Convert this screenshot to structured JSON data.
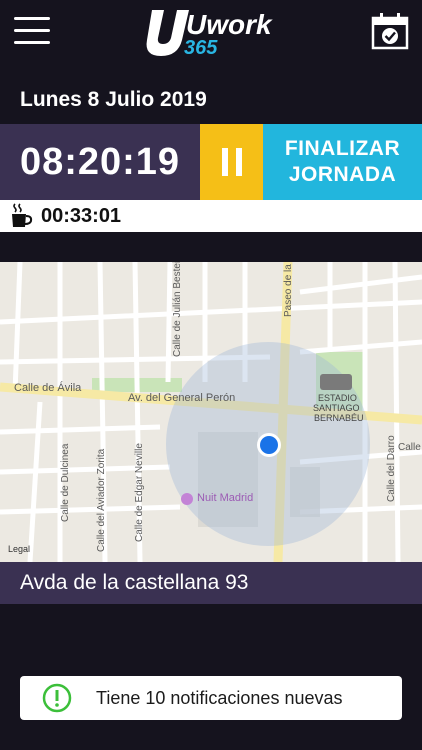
{
  "header": {
    "logo_main": "Uwork",
    "logo_sub": "365",
    "menu_icon": "hamburger-menu-icon",
    "calendar_icon": "calendar-check-icon"
  },
  "date": "Lunes 8 Julio 2019",
  "timer": {
    "elapsed": "08:20:19",
    "pause_icon": "pause-icon",
    "finish_line1": "FINALIZAR",
    "finish_line2": "JORNADA"
  },
  "break": {
    "icon": "coffee-cup-icon",
    "time": "00:33:01"
  },
  "map": {
    "labels": {
      "calle_avila": "Calle de Ávila",
      "general_peron": "Av. del General Perón",
      "estadio1": "ESTADIO",
      "estadio2": "SANTIAGO",
      "estadio3": "BERNABÉU",
      "nuit": "Nuit Madrid",
      "dulcinea": "Calle de Dulcinea",
      "aviador": "Calle del Aviador Zorita",
      "edgar": "Calle de Edgar Neville",
      "julian": "Calle de Julián Besteiro",
      "paseo": "Paseo de la",
      "darro": "Calle del Darro",
      "calle_l": "Calle L",
      "legal": "Legal"
    }
  },
  "address": "Avda de la castellana 93",
  "notification": {
    "icon": "exclamation-circle-icon",
    "text": "Tiene 10 notificaciones nuevas"
  },
  "colors": {
    "background": "#15131e",
    "timer_bg": "#3a3152",
    "pause": "#f5bf17",
    "finish": "#22b6dd",
    "location_dot": "#1a73e8",
    "notif_icon": "#3cbf3a"
  }
}
